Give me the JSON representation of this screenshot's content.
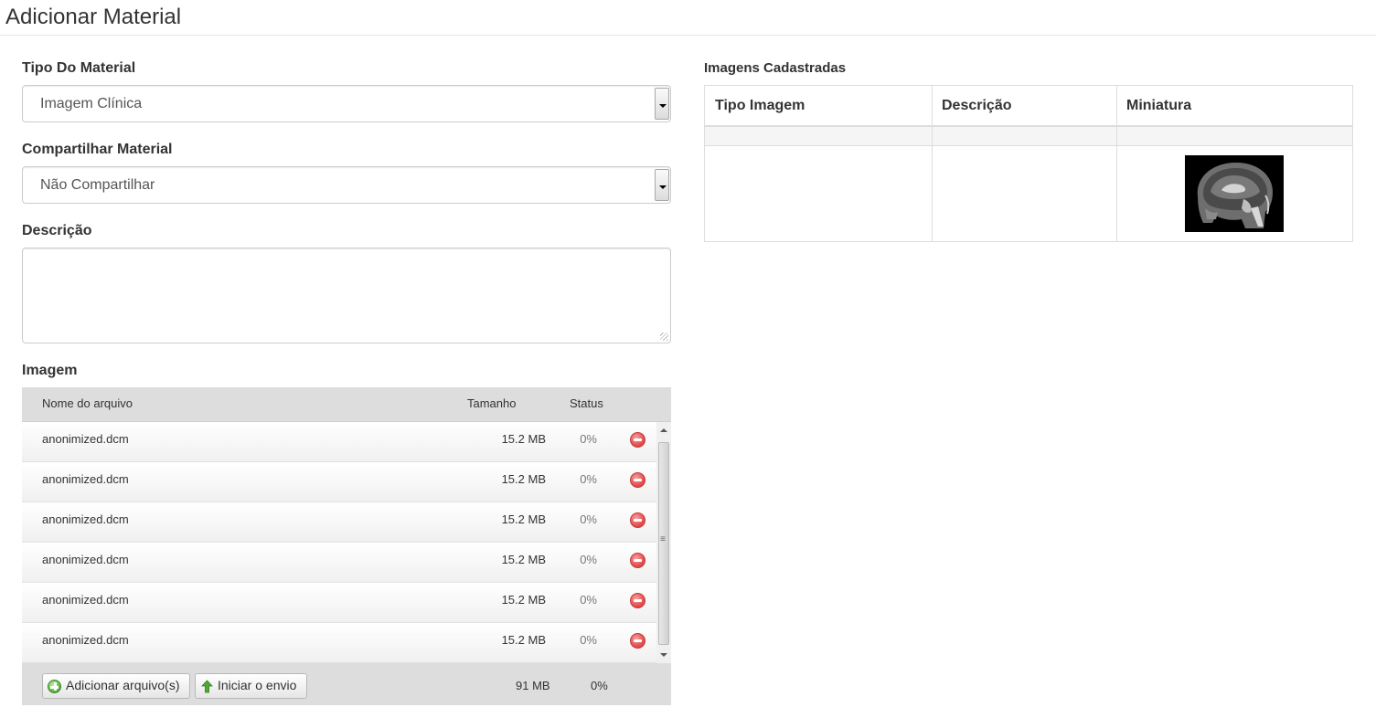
{
  "page": {
    "title": "Adicionar Material"
  },
  "form": {
    "tipo_label": "Tipo Do Material",
    "tipo_value": "Imagem Clínica",
    "compartilhar_label": "Compartilhar Material",
    "compartilhar_value": "Não Compartilhar",
    "descricao_label": "Descrição",
    "descricao_value": "",
    "imagem_label": "Imagem"
  },
  "uploader": {
    "headers": {
      "name": "Nome do arquivo",
      "size": "Tamanho",
      "status": "Status"
    },
    "files": [
      {
        "name": "anonimized.dcm",
        "size": "15.2 MB",
        "status": "0%"
      },
      {
        "name": "anonimized.dcm",
        "size": "15.2 MB",
        "status": "0%"
      },
      {
        "name": "anonimized.dcm",
        "size": "15.2 MB",
        "status": "0%"
      },
      {
        "name": "anonimized.dcm",
        "size": "15.2 MB",
        "status": "0%"
      },
      {
        "name": "anonimized.dcm",
        "size": "15.2 MB",
        "status": "0%"
      },
      {
        "name": "anonimized.dcm",
        "size": "15.2 MB",
        "status": "0%"
      }
    ],
    "add_button": "Adicionar arquivo(s)",
    "start_button": "Iniciar o envio",
    "total_size": "91 MB",
    "total_status": "0%"
  },
  "images_table": {
    "title": "Imagens Cadastradas",
    "headers": {
      "tipo": "Tipo Imagem",
      "descricao": "Descrição",
      "miniatura": "Miniatura"
    },
    "rows": [
      {
        "tipo": "",
        "descricao": "",
        "thumbnail": "brain-mri-sagittal-thumbnail"
      }
    ]
  },
  "icons": {
    "remove": "remove-circle-icon",
    "add": "add-circle-icon",
    "start": "arrow-up-icon"
  },
  "colors": {
    "header_bg": "#dddddd",
    "remove_red": "#e45050",
    "add_green": "#56b33a"
  }
}
